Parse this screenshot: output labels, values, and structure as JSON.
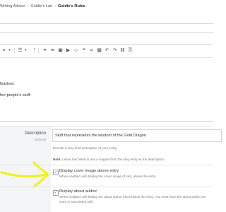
{
  "breadcrumb": {
    "items": [
      "Writing Advice",
      "Goldie's Lair",
      "Goldie's Rules"
    ],
    "separator": "›"
  },
  "editor": {
    "lines": [
      "finished.",
      "her people's stuff."
    ]
  },
  "description": {
    "label": "Description",
    "sublabel": "Optional",
    "value": "Stuff that represents the wisdom of the Gold Dragon",
    "help": "Provide a very brief description of your entry.",
    "note_prefix": "Note:",
    "note_text": " Leave this blank to use a snippet from the blog entry as the description."
  },
  "cover_image": {
    "label": "Display cover image above entry",
    "desc": "When enabled, will display the cover image (if set), above the entry.",
    "checked": true,
    "check_glyph": "✓"
  },
  "about_author": {
    "label": "Display about author",
    "desc_line1": "When enabled, will display the about author block below the entry. You must have the about author da",
    "desc_line2": "entry is associated with.",
    "checked": true,
    "check_glyph": "✓"
  },
  "annotation": {
    "color": "#f3ef1f",
    "icon": "hand-drawn-arrow"
  }
}
